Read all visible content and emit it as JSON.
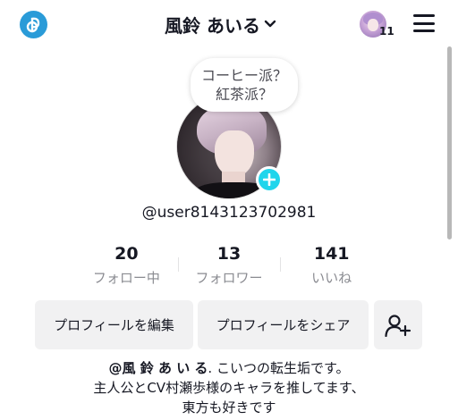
{
  "header": {
    "logo_icon": "app-logo-icon",
    "title": "風鈴 あいる",
    "dropdown_icon": "chevron-down-icon",
    "notification_count": "11",
    "menu_icon": "hamburger-menu-icon"
  },
  "profile": {
    "speech_bubble": {
      "line1": "コーヒー派？",
      "line2": "紅茶派？"
    },
    "username": "@user8143123702981"
  },
  "stats": [
    {
      "value": "20",
      "label": "フォロー中"
    },
    {
      "value": "13",
      "label": "フォロワー"
    },
    {
      "value": "141",
      "label": "いいね"
    }
  ],
  "actions": {
    "edit_profile": "プロフィールを編集",
    "share_profile": "プロフィールをシェア",
    "add_friend_icon": "add-person-icon"
  },
  "bio": {
    "handle": "@風 鈴 あ い る",
    "line1_rest": ". こいつの転生垢です。",
    "line2": "主人公とCV村瀬歩様のキャラを推してます、",
    "line3": "東方も好きです"
  },
  "colors": {
    "accent_cyan": "#20d5ec",
    "logo_blue": "#2a9bd8",
    "button_bg": "#f1f1f2",
    "text_primary": "#161823",
    "text_secondary": "#8a8b91"
  }
}
